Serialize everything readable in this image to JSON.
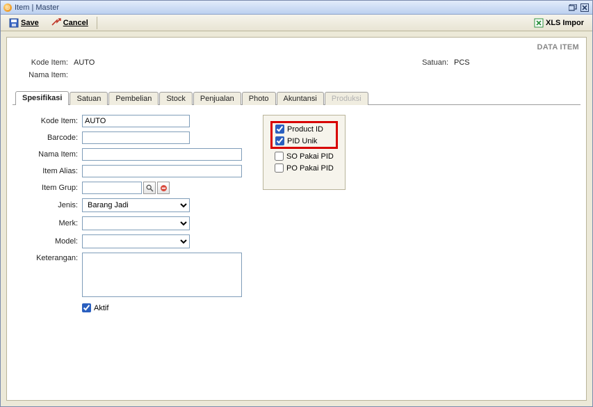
{
  "window": {
    "title": "Item | Master"
  },
  "toolbar": {
    "save_label": "Save",
    "cancel_label": "Cancel",
    "xls_import_label": "XLS Impor"
  },
  "data_item_label": "DATA ITEM",
  "header": {
    "kode_item_label": "Kode Item:",
    "kode_item_value": "AUTO",
    "nama_item_label": "Nama Item:",
    "nama_item_value": "",
    "satuan_label": "Satuan:",
    "satuan_value": "PCS"
  },
  "tabs": {
    "spesifikasi": "Spesifikasi",
    "satuan": "Satuan",
    "pembelian": "Pembelian",
    "stock": "Stock",
    "penjualan": "Penjualan",
    "photo": "Photo",
    "akuntansi": "Akuntansi",
    "produksi": "Produksi"
  },
  "form": {
    "kode_item_label": "Kode Item:",
    "kode_item_value": "AUTO",
    "barcode_label": "Barcode:",
    "barcode_value": "",
    "nama_item_label": "Nama Item:",
    "nama_item_value": "",
    "item_alias_label": "Item Alias:",
    "item_alias_value": "",
    "item_grup_label": "Item Grup:",
    "item_grup_value": "",
    "jenis_label": "Jenis:",
    "jenis_value": "Barang Jadi",
    "merk_label": "Merk:",
    "merk_value": "",
    "model_label": "Model:",
    "model_value": "",
    "keterangan_label": "Keterangan:",
    "keterangan_value": "",
    "aktif_label": "Aktif"
  },
  "side": {
    "product_id": "Product ID",
    "pid_unik": "PID Unik",
    "so_pakai_pid": "SO Pakai PID",
    "po_pakai_pid": "PO Pakai PID"
  }
}
